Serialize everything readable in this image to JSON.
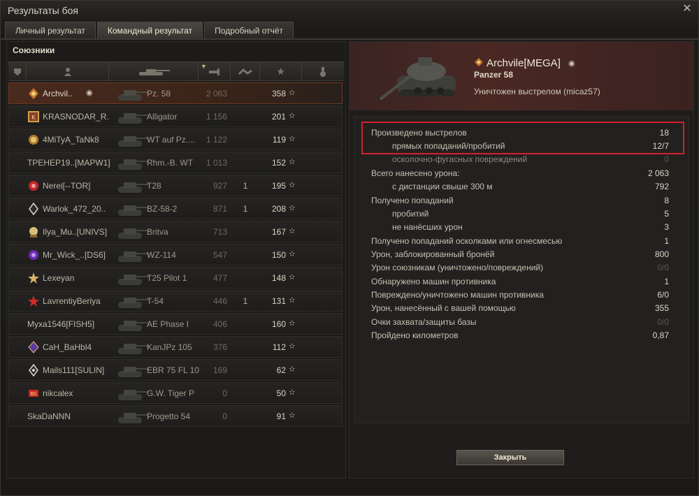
{
  "window": {
    "title": "Результаты боя"
  },
  "tabs": [
    {
      "label": "Личный результат"
    },
    {
      "label": "Командный результат"
    },
    {
      "label": "Подробный отчёт"
    }
  ],
  "allies": {
    "label": "Союзники",
    "rows": [
      {
        "name": "Archvil..",
        "tank": "Pz. 58",
        "damage": "2 063",
        "kills": "",
        "xp": "358"
      },
      {
        "name": "KRASNODAR_R..",
        "tank": "Alligator",
        "damage": "1 156",
        "kills": "",
        "xp": "201"
      },
      {
        "name": "4MiTyA_TaNk8",
        "tank": "WT auf Pz....",
        "damage": "1 122",
        "kills": "",
        "xp": "119"
      },
      {
        "name": "ТРЕНЕР19..[MAPW1]",
        "tank": "Rhm.-B. WT",
        "damage": "1 013",
        "kills": "",
        "xp": "152"
      },
      {
        "name": "Nerei[--TOR]",
        "tank": "T28",
        "damage": "927",
        "kills": "1",
        "xp": "195"
      },
      {
        "name": "Warlok_472_20..",
        "tank": "BZ-58-2",
        "damage": "871",
        "kills": "1",
        "xp": "208"
      },
      {
        "name": "Ilya_Mu..[UNIVS]",
        "tank": "Britva",
        "damage": "713",
        "kills": "",
        "xp": "167"
      },
      {
        "name": "Mr_Wick_..[DS6]",
        "tank": "WZ-114",
        "damage": "547",
        "kills": "",
        "xp": "150"
      },
      {
        "name": "Lexeyan",
        "tank": "T25 Pilot 1",
        "damage": "477",
        "kills": "",
        "xp": "148"
      },
      {
        "name": "LavrentiyBeriya",
        "tank": "T-54",
        "damage": "446",
        "kills": "1",
        "xp": "131"
      },
      {
        "name": "Myxa1546[FISH5]",
        "tank": "AE Phase I",
        "damage": "406",
        "kills": "",
        "xp": "160"
      },
      {
        "name": "CaH_BaHbl4",
        "tank": "KanJPz 105",
        "damage": "376",
        "kills": "",
        "xp": "112"
      },
      {
        "name": "Mails111[SULIN]",
        "tank": "EBR 75 FL 10",
        "damage": "169",
        "kills": "",
        "xp": "62"
      },
      {
        "name": "nikcalex",
        "tank": "G.W. Tiger P",
        "damage": "0",
        "kills": "",
        "xp": "50"
      },
      {
        "name": "SkaDaNNN",
        "tank": "Progetto 54",
        "damage": "0",
        "kills": "",
        "xp": "91"
      }
    ]
  },
  "detail": {
    "player": "Archvile[MEGA]",
    "tank": "Panzer 58",
    "status": "Уничтожен выстрелом (micaz57)",
    "stats": [
      {
        "label": "Произведено выстрелов",
        "value": "18"
      },
      {
        "label": "прямых попаданий/пробитий",
        "value": "12/7"
      },
      {
        "label": "осколочно-фугасных повреждений",
        "value": "0"
      },
      {
        "label": "Всего нанесено урона:",
        "value": "2 063"
      },
      {
        "label": "с дистанции свыше 300 м",
        "value": "792"
      },
      {
        "label": "Получено попаданий",
        "value": "8"
      },
      {
        "label": "пробитий",
        "value": "5"
      },
      {
        "label": "не нанёсших урон",
        "value": "3"
      },
      {
        "label": "Получено попаданий осколками или огнесмесью",
        "value": "1"
      },
      {
        "label": "Урон, заблокированный бронёй",
        "value": "800"
      },
      {
        "label": "Урон союзникам (уничтожено/повреждений)",
        "value": "0/0"
      },
      {
        "label": "Обнаружено машин противника",
        "value": "1"
      },
      {
        "label": "Повреждено/уничтожено машин противника",
        "value": "6/0"
      },
      {
        "label": "Урон, нанесённый с вашей помощью",
        "value": "355"
      },
      {
        "label": "Очки захвата/защиты базы",
        "value": "0/0"
      },
      {
        "label": "Пройдено километров",
        "value": "0,87"
      }
    ],
    "close_label": "Закрыть"
  },
  "colors": {
    "highlight_frame": "#d4202a",
    "accent_row": "#4a2a1e"
  }
}
